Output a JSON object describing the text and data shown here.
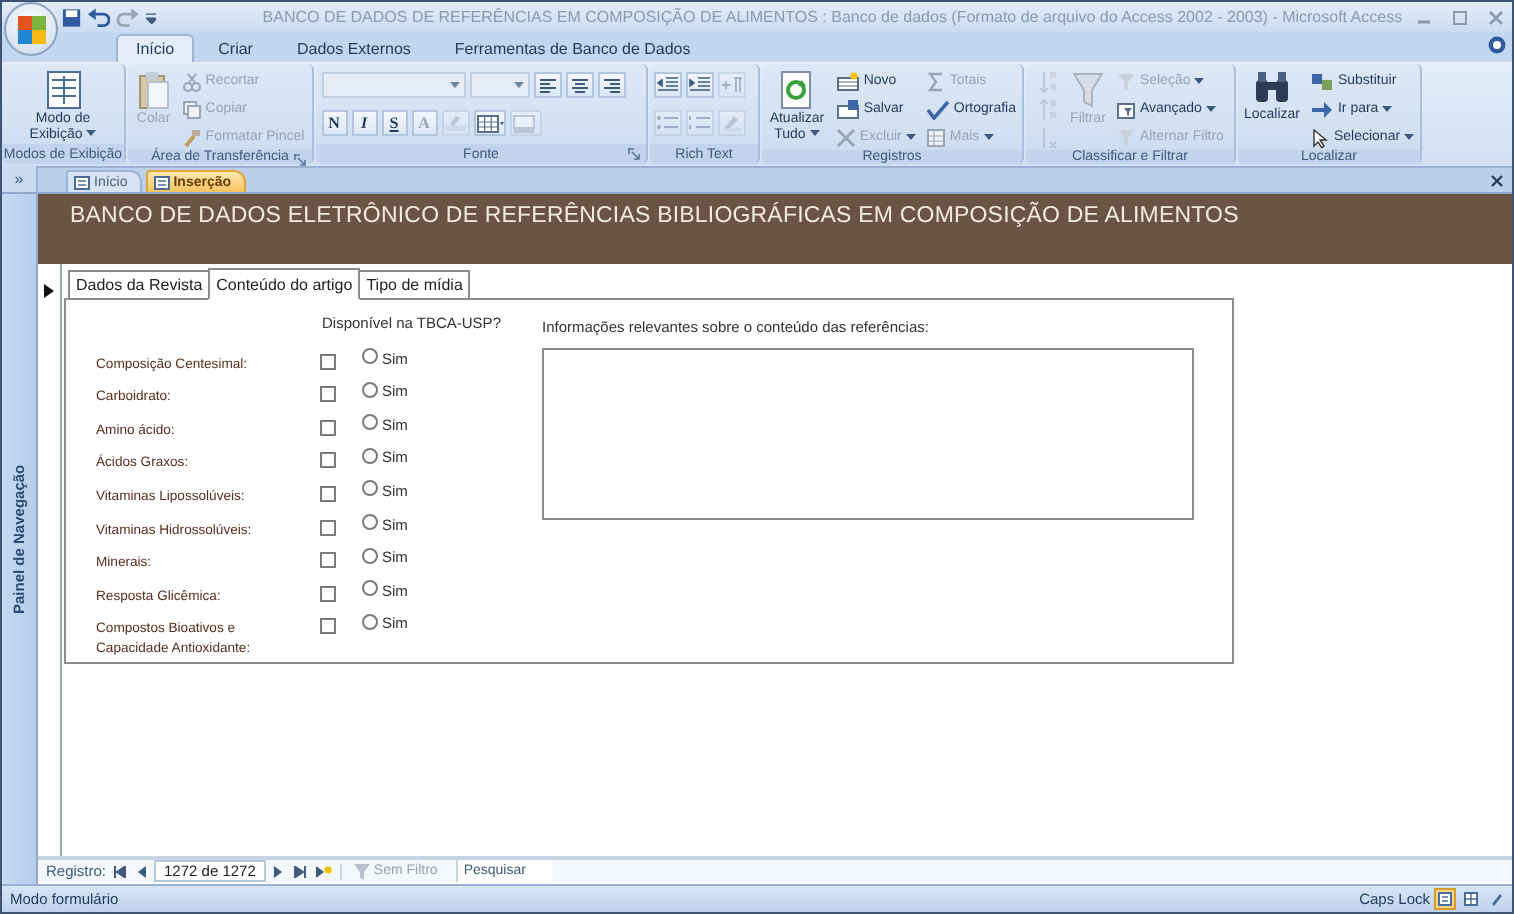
{
  "window": {
    "title": "BANCO DE DADOS DE REFERÊNCIAS EM COMPOSIÇÃO DE ALIMENTOS : Banco de dados (Formato de arquivo do Access 2002 - 2003) - Microsoft Access"
  },
  "ribbon_tabs": [
    {
      "label": "Início",
      "selected": true
    },
    {
      "label": "Criar",
      "selected": false
    },
    {
      "label": "Dados Externos",
      "selected": false
    },
    {
      "label": "Ferramentas de Banco de Dados",
      "selected": false
    }
  ],
  "ribbon_groups": [
    {
      "label": "Modos de Exibição",
      "launcher": false,
      "columns": [
        {
          "kind": "large",
          "items": [
            {
              "label": "Modo de Exibição",
              "dropdown": true,
              "disabled": false
            }
          ]
        }
      ]
    },
    {
      "label": "Área de Transferência",
      "launcher": true,
      "columns": [
        {
          "kind": "large",
          "items": [
            {
              "label": "Colar",
              "dropdown": false,
              "disabled": true
            }
          ]
        },
        {
          "kind": "stack",
          "items": [
            {
              "kind": "button",
              "label": "Recortar",
              "dropdown": false,
              "disabled": true
            },
            {
              "kind": "button",
              "label": "Copiar",
              "dropdown": false,
              "disabled": true
            },
            {
              "kind": "button",
              "label": "Formatar Pincel",
              "dropdown": false,
              "disabled": true
            }
          ]
        }
      ]
    },
    {
      "label": "Fonte",
      "launcher": true,
      "columns": [
        {
          "kind": "rows",
          "items": [
            {
              "kind": "combo",
              "disabled": true
            },
            {
              "kind": "combo",
              "disabled": true
            },
            {
              "kind": "icon",
              "disabled": false
            },
            {
              "kind": "icon",
              "disabled": false
            },
            {
              "kind": "icon",
              "disabled": false
            },
            {
              "kind": "break"
            },
            {
              "kind": "glyph",
              "label": "N",
              "disabled": false
            },
            {
              "kind": "glyph",
              "label": "I",
              "disabled": false
            },
            {
              "kind": "glyph",
              "label": "S",
              "disabled": false
            },
            {
              "kind": "glyph",
              "label": "A",
              "disabled": true
            },
            {
              "kind": "icon",
              "disabled": true
            },
            {
              "kind": "icon",
              "disabled": false
            },
            {
              "kind": "icon",
              "disabled": true
            }
          ]
        }
      ]
    },
    {
      "label": "Rich Text",
      "launcher": false,
      "columns": [
        {
          "kind": "rows",
          "items": [
            {
              "kind": "icon",
              "disabled": false
            },
            {
              "kind": "icon",
              "disabled": false
            },
            {
              "kind": "icon",
              "disabled": true
            },
            {
              "kind": "break"
            },
            {
              "kind": "icon",
              "disabled": true
            },
            {
              "kind": "icon",
              "disabled": true
            },
            {
              "kind": "icon",
              "disabled": true
            }
          ]
        }
      ]
    },
    {
      "label": "Registros",
      "launcher": false,
      "columns": [
        {
          "kind": "large",
          "items": [
            {
              "label": "Atualizar Tudo",
              "dropdown": true,
              "disabled": false
            }
          ]
        },
        {
          "kind": "stack",
          "items": [
            {
              "kind": "button",
              "label": "Novo",
              "dropdown": false,
              "disabled": false
            },
            {
              "kind": "button",
              "label": "Salvar",
              "dropdown": false,
              "disabled": false
            },
            {
              "kind": "button",
              "label": "Excluir",
              "dropdown": true,
              "disabled": true
            }
          ]
        },
        {
          "kind": "stack",
          "items": [
            {
              "kind": "button",
              "label": "Totais",
              "dropdown": false,
              "disabled": true
            },
            {
              "kind": "button",
              "label": "Ortografia",
              "dropdown": false,
              "disabled": false
            },
            {
              "kind": "button",
              "label": "Mais",
              "dropdown": true,
              "disabled": true
            }
          ]
        }
      ]
    },
    {
      "label": "Classificar e Filtrar",
      "launcher": false,
      "columns": [
        {
          "kind": "stack",
          "items": [
            {
              "kind": "icon",
              "disabled": true
            },
            {
              "kind": "icon",
              "disabled": true
            },
            {
              "kind": "icon",
              "disabled": true
            }
          ]
        },
        {
          "kind": "large",
          "items": [
            {
              "label": "Filtrar",
              "dropdown": false,
              "disabled": true
            }
          ]
        },
        {
          "kind": "stack",
          "items": [
            {
              "kind": "button",
              "label": "Seleção",
              "dropdown": true,
              "disabled": true
            },
            {
              "kind": "button",
              "label": "Avançado",
              "dropdown": true,
              "disabled": false
            },
            {
              "kind": "button",
              "label": "Alternar Filtro",
              "dropdown": false,
              "disabled": true
            }
          ]
        }
      ]
    },
    {
      "label": "Localizar",
      "launcher": false,
      "columns": [
        {
          "kind": "large",
          "items": [
            {
              "label": "Localizar",
              "dropdown": false,
              "disabled": false
            }
          ]
        },
        {
          "kind": "stack",
          "items": [
            {
              "kind": "button",
              "label": "Substituir",
              "dropdown": false,
              "disabled": false
            },
            {
              "kind": "button",
              "label": "Ir para",
              "dropdown": true,
              "disabled": false
            },
            {
              "kind": "button",
              "label": "Selecionar",
              "dropdown": true,
              "disabled": false
            }
          ]
        }
      ]
    }
  ],
  "nav_toggle": "»",
  "document_tabs": [
    {
      "label": "Início",
      "selected": false
    },
    {
      "label": "Inserção",
      "selected": true
    }
  ],
  "navigation_pane": {
    "label": "Painel de Navegação"
  },
  "form": {
    "title": "BANCO DE DADOS ELETRÔNICO DE REFERÊNCIAS BIBLIOGRÁFICAS EM COMPOSIÇÃO DE ALIMENTOS",
    "tabs": [
      {
        "label": "Dados da Revista",
        "selected": false
      },
      {
        "label": "Conteúdo do artigo",
        "selected": true
      },
      {
        "label": "Tipo de mídia",
        "selected": false
      }
    ],
    "availability_heading": "Disponível na TBCA-USP?",
    "fields": [
      {
        "label": "Composição Centesimal:",
        "checked": false,
        "option": "Sim",
        "selected": false
      },
      {
        "label": "Carboidrato:",
        "checked": false,
        "option": "Sim",
        "selected": false
      },
      {
        "label": "Amino ácido:",
        "checked": false,
        "option": "Sim",
        "selected": false
      },
      {
        "label": "Ácidos Graxos:",
        "checked": false,
        "option": "Sim",
        "selected": false
      },
      {
        "label": "Vitaminas Lipossolúveis:",
        "checked": false,
        "option": "Sim",
        "selected": false
      },
      {
        "label": "Vitaminas Hidrossolúveis:",
        "checked": false,
        "option": "Sim",
        "selected": false
      },
      {
        "label": "Minerais:",
        "checked": false,
        "option": "Sim",
        "selected": false
      },
      {
        "label": "Resposta Glicêmica:",
        "checked": false,
        "option": "Sim",
        "selected": false
      },
      {
        "label": "Compostos Bioativos e Capacidade Antioxidante:",
        "checked": false,
        "option": "Sim",
        "selected": false
      }
    ],
    "notes_label": "Informações relevantes sobre o conteúdo das referências:"
  },
  "record_nav": {
    "label": "Registro:",
    "position": "1272 de 1272",
    "filter": {
      "label": "Sem Filtro",
      "disabled": true
    },
    "search": {
      "placeholder": "Pesquisar"
    }
  },
  "status_bar": {
    "mode": "Modo formulário",
    "caps_lock": "Caps Lock",
    "views": [
      {
        "selected": true
      },
      {
        "selected": false
      },
      {
        "selected": false
      }
    ]
  }
}
